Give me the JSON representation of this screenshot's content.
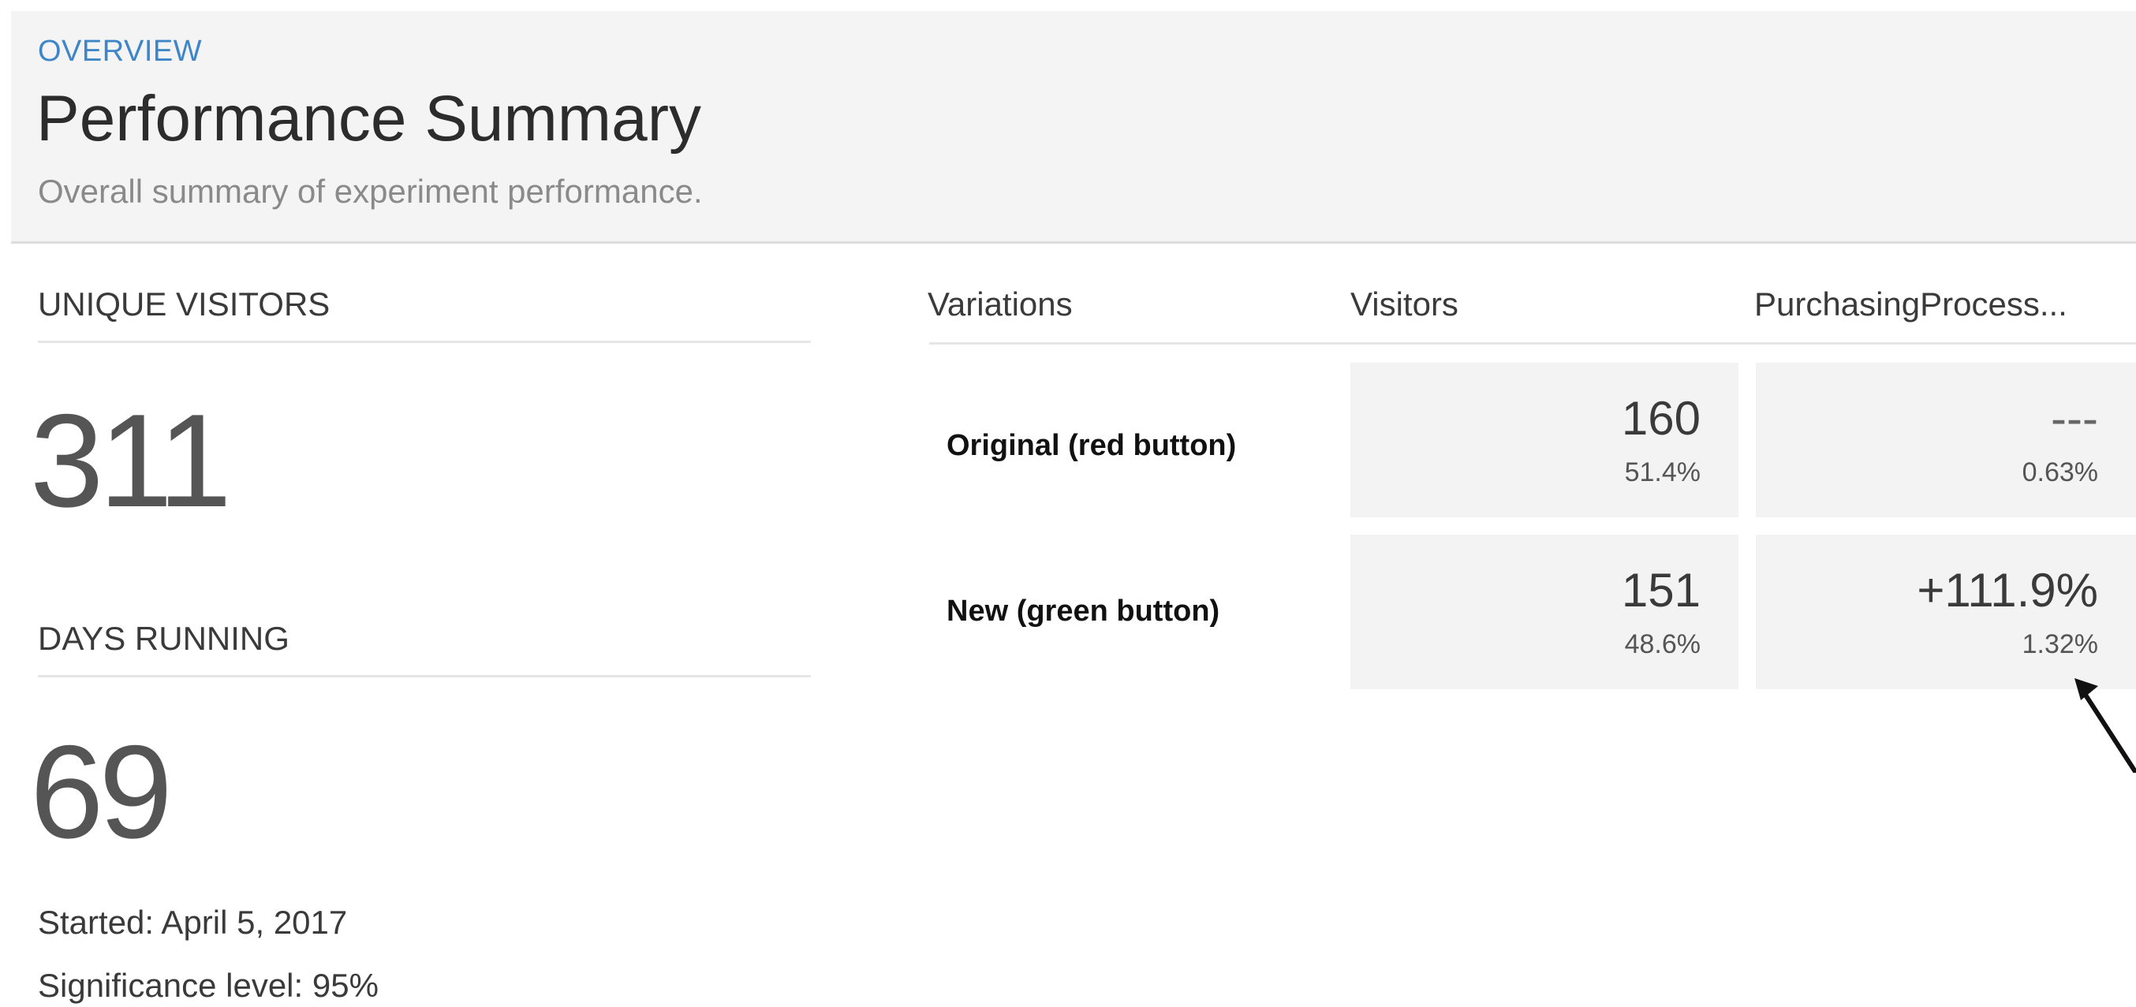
{
  "header": {
    "eyebrow": "OVERVIEW",
    "title": "Performance Summary",
    "subtitle": "Overall summary of experiment performance."
  },
  "stats": {
    "unique_visitors_label": "UNIQUE VISITORS",
    "unique_visitors_value": "311",
    "days_running_label": "DAYS RUNNING",
    "days_running_value": "69",
    "started": "Started: April 5, 2017",
    "significance": "Significance level: 95%"
  },
  "table": {
    "headers": {
      "variations": "Variations",
      "visitors": "Visitors",
      "goal": "PurchasingProcess..."
    },
    "rows": [
      {
        "name": "Original (red button)",
        "visitors": "160",
        "visitors_pct": "51.4%",
        "goal_main": "---",
        "goal_rate": "0.63%"
      },
      {
        "name": "New (green button)",
        "visitors": "151",
        "visitors_pct": "48.6%",
        "goal_main": "+111.9%",
        "goal_rate": "1.32%"
      }
    ]
  },
  "colors": {
    "accent": "#3f86c9",
    "header_bg": "#f4f4f4",
    "cell_bg": "#f3f3f3"
  },
  "icons": {
    "annotation_arrow": "arrow-up-left-icon"
  }
}
